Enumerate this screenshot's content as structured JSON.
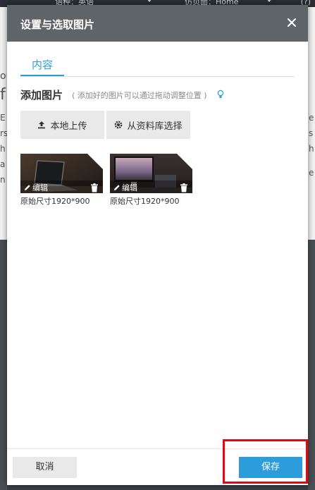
{
  "background": {
    "lang_select": "语种：英语",
    "page_select": "仿页面：Home",
    "help": "(?)",
    "left_chars": [
      "ou",
      "f",
      "E",
      "rs",
      "h",
      "a",
      "n"
    ],
    "right_chars": [
      "e",
      "s",
      "h",
      "e"
    ]
  },
  "modal": {
    "title": "设置与选取图片",
    "close_icon": "close-icon",
    "tabs": [
      {
        "label": "内容",
        "active": true
      }
    ],
    "section_title": "添加图片",
    "section_hint": "( 添加好的图片可以通过拖动调整位置 )",
    "upload_button": "本地上传",
    "library_button": "从资料库选择",
    "images": [
      {
        "index": "1",
        "edit_label": "编辑",
        "size_label": "原始尺寸1920*900"
      },
      {
        "index": "2",
        "edit_label": "编辑",
        "size_label": "原始尺寸1920*900"
      }
    ],
    "cancel_button": "取消",
    "save_button": "保存"
  },
  "colors": {
    "accent": "#2d9cdb",
    "header": "#5f6468",
    "highlight": "#e30613"
  }
}
